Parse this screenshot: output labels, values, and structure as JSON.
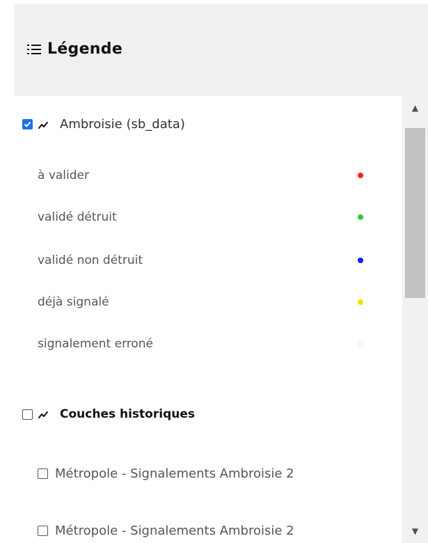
{
  "panel": {
    "title": "Légende",
    "title_icon": "list-icon"
  },
  "layers": [
    {
      "name": "Ambroisie (sb_data)",
      "checked": true,
      "icon": "trend-line-icon",
      "legend": [
        {
          "label": "à valider",
          "color": "#ff1f1f"
        },
        {
          "label": "validé détruit",
          "color": "#2ecc40"
        },
        {
          "label": "validé non détruit",
          "color": "#1a1aff"
        },
        {
          "label": "déjà signalé",
          "color": "#e6e600"
        },
        {
          "label": "signalement erroné",
          "color": "#f6f6f6"
        }
      ]
    }
  ],
  "group": {
    "name": "Couches historiques",
    "checked": false,
    "icon": "trend-line-icon",
    "sublayers": [
      {
        "label": "Métropole - Signalements Ambroisie 2",
        "checked": false
      },
      {
        "label": "Métropole - Signalements Ambroisie 2",
        "checked": false
      }
    ]
  },
  "scrollbar": {
    "up_icon": "▲",
    "down_icon": "▼"
  }
}
